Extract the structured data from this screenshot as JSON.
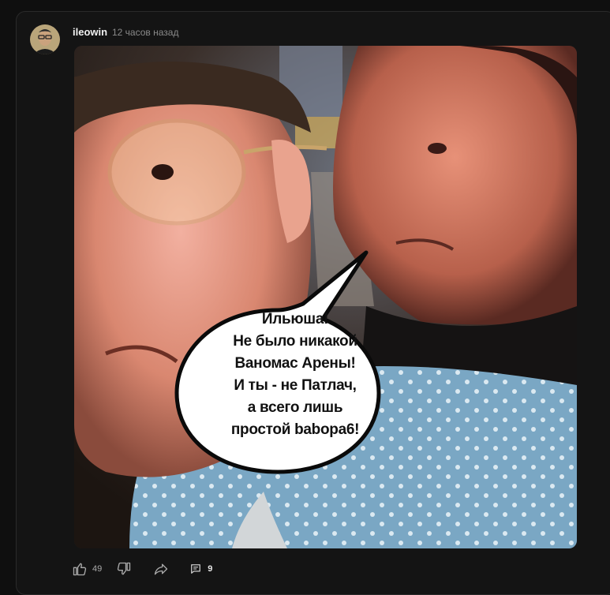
{
  "post": {
    "author": "ileowin",
    "time": "12 часов назад",
    "image": {
      "speech_lines": [
        "Ильюша!",
        "Не было никакой",
        "Ваномас Арены!",
        "И ты - не Патлач,",
        "а всего лишь",
        "простой babopa6!"
      ]
    },
    "actions": {
      "likes": "49",
      "comments": "9"
    }
  },
  "icons": {
    "like": "thumbs-up-icon",
    "dislike": "thumbs-down-icon",
    "share": "share-arrow-icon",
    "comments": "comment-icon"
  },
  "colors": {
    "background": "#0f0f0f",
    "card": "#141414",
    "text_primary": "#f1f1f1",
    "text_secondary": "#8a8a8a"
  }
}
